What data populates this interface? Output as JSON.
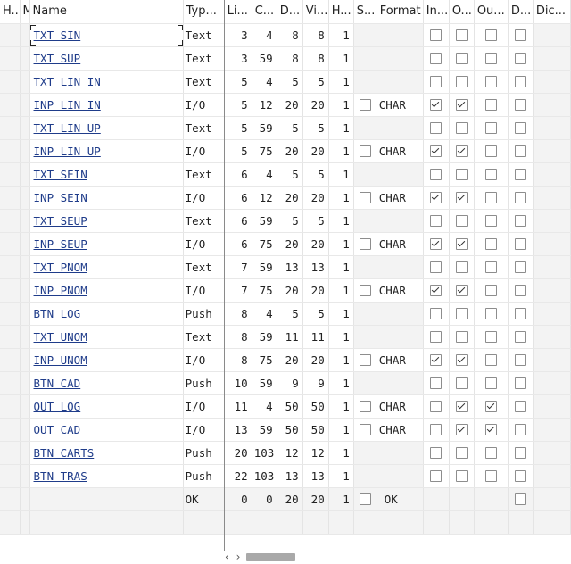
{
  "columns": [
    "H...",
    "M",
    "Name",
    "Typ...",
    "Li...",
    "C...",
    "D...",
    "Vi...",
    "H...",
    "S...",
    "Format",
    "In...",
    "O...",
    "Ou...",
    "D...",
    "Dic..."
  ],
  "rows": [
    {
      "name": "TXT SIN",
      "type": "Text",
      "line": "3",
      "col": "4",
      "def": "8",
      "vis": "8",
      "h": "1",
      "s": null,
      "format": "",
      "in": false,
      "o": false,
      "ou": false,
      "d": false
    },
    {
      "name": "TXT SUP",
      "type": "Text",
      "line": "3",
      "col": "59",
      "def": "8",
      "vis": "8",
      "h": "1",
      "s": null,
      "format": "",
      "in": false,
      "o": false,
      "ou": false,
      "d": false
    },
    {
      "name": "TXT LIN IN",
      "type": "Text",
      "line": "5",
      "col": "4",
      "def": "5",
      "vis": "5",
      "h": "1",
      "s": null,
      "format": "",
      "in": false,
      "o": false,
      "ou": false,
      "d": false
    },
    {
      "name": "INP LIN IN",
      "type": "I/O",
      "line": "5",
      "col": "12",
      "def": "20",
      "vis": "20",
      "h": "1",
      "s": false,
      "format": "CHAR",
      "in": true,
      "o": true,
      "ou": false,
      "d": false
    },
    {
      "name": "TXT LIN UP",
      "type": "Text",
      "line": "5",
      "col": "59",
      "def": "5",
      "vis": "5",
      "h": "1",
      "s": null,
      "format": "",
      "in": false,
      "o": false,
      "ou": false,
      "d": false
    },
    {
      "name": "INP LIN UP",
      "type": "I/O",
      "line": "5",
      "col": "75",
      "def": "20",
      "vis": "20",
      "h": "1",
      "s": false,
      "format": "CHAR",
      "in": true,
      "o": true,
      "ou": false,
      "d": false
    },
    {
      "name": "TXT SEIN",
      "type": "Text",
      "line": "6",
      "col": "4",
      "def": "5",
      "vis": "5",
      "h": "1",
      "s": null,
      "format": "",
      "in": false,
      "o": false,
      "ou": false,
      "d": false
    },
    {
      "name": "INP SEIN",
      "type": "I/O",
      "line": "6",
      "col": "12",
      "def": "20",
      "vis": "20",
      "h": "1",
      "s": false,
      "format": "CHAR",
      "in": true,
      "o": true,
      "ou": false,
      "d": false
    },
    {
      "name": "TXT SEUP",
      "type": "Text",
      "line": "6",
      "col": "59",
      "def": "5",
      "vis": "5",
      "h": "1",
      "s": null,
      "format": "",
      "in": false,
      "o": false,
      "ou": false,
      "d": false
    },
    {
      "name": "INP SEUP",
      "type": "I/O",
      "line": "6",
      "col": "75",
      "def": "20",
      "vis": "20",
      "h": "1",
      "s": false,
      "format": "CHAR",
      "in": true,
      "o": true,
      "ou": false,
      "d": false
    },
    {
      "name": "TXT PNOM",
      "type": "Text",
      "line": "7",
      "col": "59",
      "def": "13",
      "vis": "13",
      "h": "1",
      "s": null,
      "format": "",
      "in": false,
      "o": false,
      "ou": false,
      "d": false
    },
    {
      "name": "INP PNOM",
      "type": "I/O",
      "line": "7",
      "col": "75",
      "def": "20",
      "vis": "20",
      "h": "1",
      "s": false,
      "format": "CHAR",
      "in": true,
      "o": true,
      "ou": false,
      "d": false
    },
    {
      "name": "BTN LOG",
      "type": "Push",
      "line": "8",
      "col": "4",
      "def": "5",
      "vis": "5",
      "h": "1",
      "s": null,
      "format": "",
      "in": false,
      "o": false,
      "ou": false,
      "d": false
    },
    {
      "name": "TXT UNOM",
      "type": "Text",
      "line": "8",
      "col": "59",
      "def": "11",
      "vis": "11",
      "h": "1",
      "s": null,
      "format": "",
      "in": false,
      "o": false,
      "ou": false,
      "d": false
    },
    {
      "name": "INP UNOM",
      "type": "I/O",
      "line": "8",
      "col": "75",
      "def": "20",
      "vis": "20",
      "h": "1",
      "s": false,
      "format": "CHAR",
      "in": true,
      "o": true,
      "ou": false,
      "d": false
    },
    {
      "name": "BTN CAD",
      "type": "Push",
      "line": "10",
      "col": "59",
      "def": "9",
      "vis": "9",
      "h": "1",
      "s": null,
      "format": "",
      "in": false,
      "o": false,
      "ou": false,
      "d": false
    },
    {
      "name": "OUT LOG",
      "type": "I/O",
      "line": "11",
      "col": "4",
      "def": "50",
      "vis": "50",
      "h": "1",
      "s": false,
      "format": "CHAR",
      "in": false,
      "o": true,
      "ou": true,
      "d": false
    },
    {
      "name": "OUT CAD",
      "type": "I/O",
      "line": "13",
      "col": "59",
      "def": "50",
      "vis": "50",
      "h": "1",
      "s": false,
      "format": "CHAR",
      "in": false,
      "o": true,
      "ou": true,
      "d": false
    },
    {
      "name": "BTN CARTS",
      "type": "Push",
      "line": "20",
      "col": "103",
      "def": "12",
      "vis": "12",
      "h": "1",
      "s": null,
      "format": "",
      "in": false,
      "o": false,
      "ou": false,
      "d": false
    },
    {
      "name": "BTN TRAS",
      "type": "Push",
      "line": "22",
      "col": "103",
      "def": "13",
      "vis": "13",
      "h": "1",
      "s": null,
      "format": "",
      "in": false,
      "o": false,
      "ou": false,
      "d": false
    }
  ],
  "footer_row": {
    "type": "OK",
    "line": "0",
    "col": "0",
    "def": "20",
    "vis": "20",
    "h": "1",
    "format": "OK"
  },
  "scroll_arrows": "‹ ›"
}
